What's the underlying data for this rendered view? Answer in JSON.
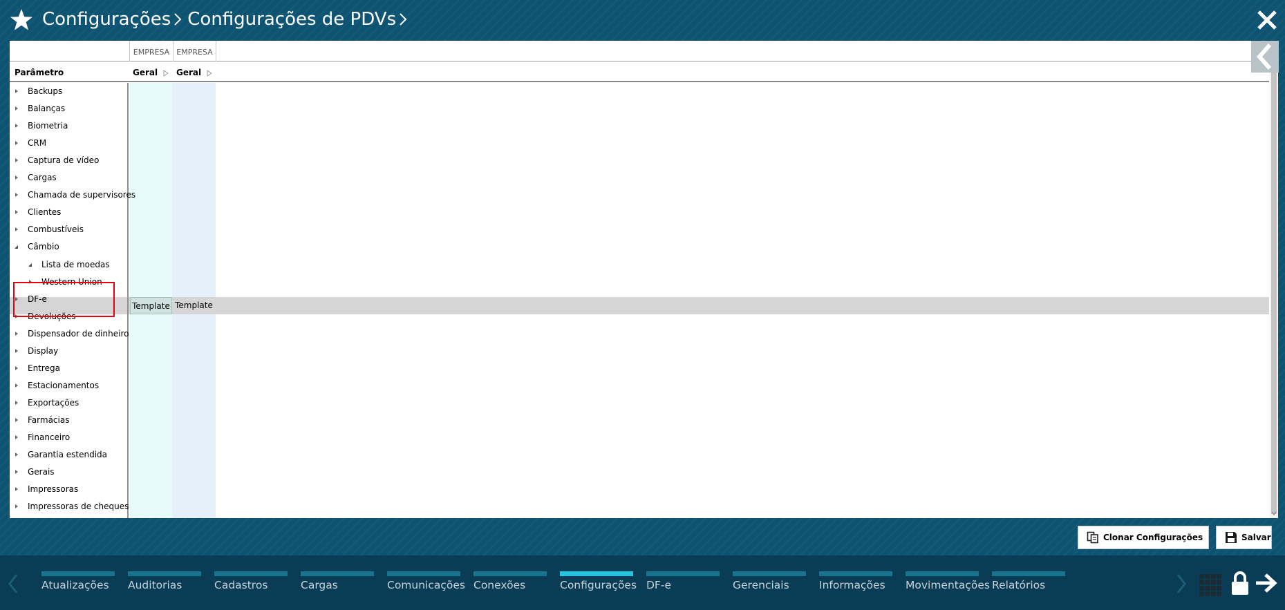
{
  "header": {
    "breadcrumb": [
      "Configurações",
      "Configurações de PDVs"
    ],
    "star_icon": "star-icon",
    "close_icon": "close-icon"
  },
  "grid": {
    "columns": [
      {
        "group": "EMPRESA",
        "name": "Geral",
        "row_value": "Template"
      },
      {
        "group": "EMPRESA",
        "name": "Geral",
        "row_value": "Template"
      }
    ],
    "param_header": "Parâmetro",
    "tree": [
      {
        "label": "Backups",
        "level": 0,
        "expanded": false
      },
      {
        "label": "Balanças",
        "level": 0,
        "expanded": false
      },
      {
        "label": "Biometria",
        "level": 0,
        "expanded": false
      },
      {
        "label": "CRM",
        "level": 0,
        "expanded": false
      },
      {
        "label": "Captura de vídeo",
        "level": 0,
        "expanded": false
      },
      {
        "label": "Cargas",
        "level": 0,
        "expanded": false
      },
      {
        "label": "Chamada de supervisores",
        "level": 0,
        "expanded": false
      },
      {
        "label": "Clientes",
        "level": 0,
        "expanded": false
      },
      {
        "label": "Combustíveis",
        "level": 0,
        "expanded": false
      },
      {
        "label": "Câmbio",
        "level": 0,
        "expanded": true
      },
      {
        "label": "Lista de moedas",
        "level": 1,
        "expanded": true,
        "selected": true
      },
      {
        "label": "Western Union",
        "level": 1,
        "expanded": false
      },
      {
        "label": "DF-e",
        "level": 0,
        "expanded": false
      },
      {
        "label": "Devoluções",
        "level": 0,
        "expanded": false
      },
      {
        "label": "Dispensador de dinheiro",
        "level": 0,
        "expanded": false
      },
      {
        "label": "Display",
        "level": 0,
        "expanded": false
      },
      {
        "label": "Entrega",
        "level": 0,
        "expanded": false
      },
      {
        "label": "Estacionamentos",
        "level": 0,
        "expanded": false
      },
      {
        "label": "Exportações",
        "level": 0,
        "expanded": false
      },
      {
        "label": "Farmácias",
        "level": 0,
        "expanded": false
      },
      {
        "label": "Financeiro",
        "level": 0,
        "expanded": false
      },
      {
        "label": "Garantia estendida",
        "level": 0,
        "expanded": false
      },
      {
        "label": "Gerais",
        "level": 0,
        "expanded": false
      },
      {
        "label": "Impressoras",
        "level": 0,
        "expanded": false
      },
      {
        "label": "Impressoras de cheques",
        "level": 0,
        "expanded": false
      }
    ]
  },
  "actions": {
    "clone_label": "Clonar Configurações",
    "save_label": "Salvar"
  },
  "bottom_nav": {
    "items": [
      {
        "label": "Atualizações",
        "active": false
      },
      {
        "label": "Auditorias",
        "active": false
      },
      {
        "label": "Cadastros",
        "active": false
      },
      {
        "label": "Cargas",
        "active": false
      },
      {
        "label": "Comunicações",
        "active": false
      },
      {
        "label": "Conexões",
        "active": false
      },
      {
        "label": "Configurações",
        "active": true
      },
      {
        "label": "DF-e",
        "active": false
      },
      {
        "label": "Gerenciais",
        "active": false
      },
      {
        "label": "Informações",
        "active": false
      },
      {
        "label": "Movimentações",
        "active": false
      },
      {
        "label": "Relatórios",
        "active": false
      }
    ]
  },
  "colors": {
    "background": "#0e5472",
    "bottom_bar": "#0a3c55",
    "nav_bar": "#19758f",
    "nav_bar_active": "#23c3e2",
    "highlight": "#e3000f",
    "selected_row": "#d5d5d5"
  }
}
